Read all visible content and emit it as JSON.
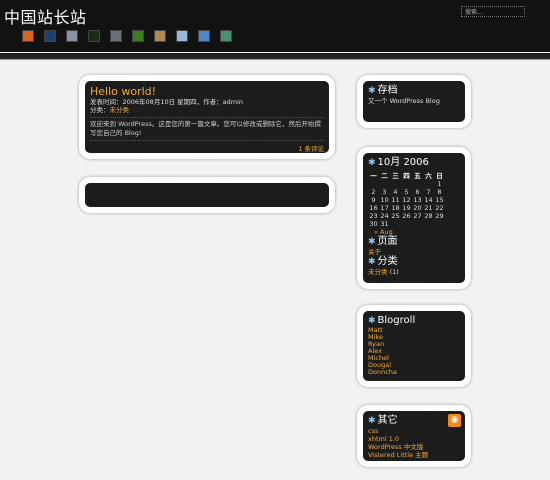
{
  "site": {
    "title": "中国站长站"
  },
  "search": {
    "value": "搜索..."
  },
  "themes": [
    {
      "name": "orange",
      "color": "#d7641f"
    },
    {
      "name": "navy",
      "color": "#1f3f6e"
    },
    {
      "name": "gray",
      "color": "#8a93a3"
    },
    {
      "name": "dark-green",
      "color": "#1e2b14"
    },
    {
      "name": "slate",
      "color": "#6b7078"
    },
    {
      "name": "lime-stripe",
      "color": "#3e7d1e"
    },
    {
      "name": "tan",
      "color": "#b08a52"
    },
    {
      "name": "sky",
      "color": "#9ab6d8"
    },
    {
      "name": "blue",
      "color": "#4d86c9"
    },
    {
      "name": "teal",
      "color": "#4a8f74"
    }
  ],
  "post": {
    "title": "Hello world!",
    "meta_line": "发表时间：2006年08月10日 星期四，作者：admin",
    "category_label": "分类：",
    "category": "未分类",
    "body": "欢迎来到 WordPress。这是您的第一篇文章。您可以修改或删除它，然后开始撰写您自己的 Blog!",
    "comments": "1 条评论"
  },
  "archives": {
    "title": "存档",
    "text": "又一个 WordPress Blog"
  },
  "calendar": {
    "title": "10月 2006",
    "weekdays": [
      "一",
      "二",
      "三",
      "四",
      "五",
      "六",
      "日"
    ],
    "weeks": [
      [
        "",
        "",
        "",
        "",
        "",
        "",
        "1"
      ],
      [
        "2",
        "3",
        "4",
        "5",
        "6",
        "7",
        "8"
      ],
      [
        "9",
        "10",
        "11",
        "12",
        "13",
        "14",
        "15"
      ],
      [
        "16",
        "17",
        "18",
        "19",
        "20",
        "21",
        "22"
      ],
      [
        "23",
        "24",
        "25",
        "26",
        "27",
        "28",
        "29"
      ],
      [
        "30",
        "31",
        "",
        "",
        "",
        "",
        ""
      ]
    ],
    "prev": "« Aug"
  },
  "pages": {
    "title": "页面",
    "items": [
      "关于"
    ]
  },
  "categories": {
    "title": "分类",
    "item": "未分类",
    "count": "(1)"
  },
  "blogroll": {
    "title": "Blogroll",
    "items": [
      "Matt",
      "Mike",
      "Ryan",
      "Alex",
      "Michel",
      "Dougal",
      "Donncha"
    ]
  },
  "other": {
    "title": "其它",
    "items": [
      "css",
      "xhtml 1.0",
      "WordPress 中文版",
      "Vistered Little 主题"
    ]
  },
  "icons": {
    "widget": "star-icon",
    "feed": "rss-icon"
  }
}
